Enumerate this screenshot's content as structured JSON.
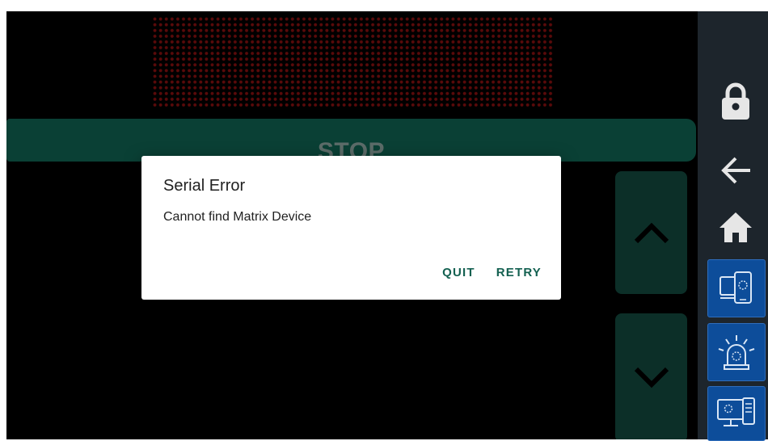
{
  "display": {
    "status_label": "STOP"
  },
  "dialog": {
    "title": "Serial Error",
    "message": "Cannot find Matrix Device",
    "buttons": {
      "quit": "QUIT",
      "retry": "RETRY"
    }
  },
  "controls": {
    "up_icon": "chevron-up-icon",
    "down_icon": "chevron-down-icon"
  },
  "sidebar": {
    "items": [
      {
        "icon": "lock-icon"
      },
      {
        "icon": "back-arrow-icon"
      },
      {
        "icon": "home-icon"
      },
      {
        "icon": "device-sync-icon"
      },
      {
        "icon": "alarm-beacon-icon"
      },
      {
        "icon": "computer-display-icon"
      }
    ]
  },
  "colors": {
    "stop_bar": "#0a4035",
    "arrow_button": "#0c2f28",
    "sidebar_bg": "#1d252c",
    "sidebar_button": "#0d4d9a",
    "dialog_accent": "#136050",
    "matrix_led": "#5a0a0a"
  }
}
